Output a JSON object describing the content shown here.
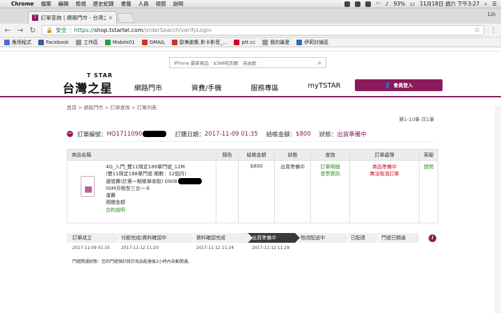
{
  "menubar": {
    "app": "Chrome",
    "items": [
      "檔案",
      "編輯",
      "檢視",
      "歷史紀錄",
      "書籤",
      "人員",
      "視窗",
      "說明"
    ],
    "battery": "93%",
    "clock": "11月18日 週六 下午3:27"
  },
  "tab": {
    "title": "訂單查詢 | 網路門市 - 台灣之星",
    "close": "×"
  },
  "profile_name": "Lin",
  "address": {
    "secure_label": "安全",
    "protocol": "https://",
    "host": "shop.tstartel.com",
    "path": "/orderSearch/verifyLogin"
  },
  "bookmarks": [
    {
      "label": "應用程式",
      "color": "#4a6ee0"
    },
    {
      "label": "Facebook",
      "color": "#3b5998"
    },
    {
      "label": "工作區",
      "color": "#999999"
    },
    {
      "label": "Mobile01",
      "color": "#2a9d3a"
    },
    {
      "label": "GMAIL",
      "color": "#d93025"
    },
    {
      "label": "歐美劇集,影卡影音_...",
      "color": "#c0392b"
    },
    {
      "label": "ptt.cc",
      "color": "#d0021b"
    },
    {
      "label": "我的最愛",
      "color": "#999999"
    },
    {
      "label": "伊莉討論區",
      "color": "#2d6db5"
    }
  ],
  "site": {
    "search_hint": "iPhone 最新買品　$388吃到飽　自由配",
    "logo_en": "T STAR",
    "logo_zh": "台灣之星",
    "nav": [
      "網路門市",
      "資費/手機",
      "服務專區",
      "myTSTAR"
    ],
    "login_label": "會員登入",
    "breadcrumb": "首頁 > 網路門市 > 訂單查詢 > 訂單列表",
    "page_info": "第1-10筆 共1筆"
  },
  "order": {
    "number_label": "訂單編號：",
    "number_value": "HQ1711090",
    "date_label": "訂購日期：",
    "date_value": "2017-11-09 01:35",
    "amount_label": "結帳金額：",
    "amount_value": "$800",
    "status_label": "狀態：",
    "status_value": "出貨準備中"
  },
  "table": {
    "headers": [
      "商品名稱",
      "顏色",
      "結帳金額",
      "狀態",
      "查詢",
      "訂單處理",
      "客服"
    ],
    "product_lines": [
      "4G_入門_雙11限定188單門號_12M",
      "(雙11限定188單門號 期數：12個月)",
      "選號費(於第一期帳單收取) 0908",
      "ISIM月租型三合一卡",
      "運費",
      "預繳金額"
    ],
    "contract_link": "合約說明",
    "color": "",
    "amount": "$800",
    "status": "出貨準備中",
    "query_detail": "訂單明細",
    "query_invoice": "發票資訊",
    "processing_status": "商品準備中",
    "processing_note": "無法取消訂單",
    "service_link": "提問"
  },
  "steps": [
    {
      "label": "訂單成立",
      "date": "2017-11-09 01:35"
    },
    {
      "label": "付款完成/資料確認中",
      "date": "2017-11-12 11:20"
    },
    {
      "label": "資料確認完成",
      "date": "2017-11-12 11:24"
    },
    {
      "label": "出貨準備中",
      "date": "2017-11-12 11:29"
    },
    {
      "label": "物流配送中",
      "date": ""
    },
    {
      "label": "已配達",
      "date": ""
    },
    {
      "label": "門號已開通",
      "date": ""
    }
  ],
  "active_step": 3,
  "notice": "門號開通狀態：您的門號預計將於商品配達後2小時內自動開通。"
}
